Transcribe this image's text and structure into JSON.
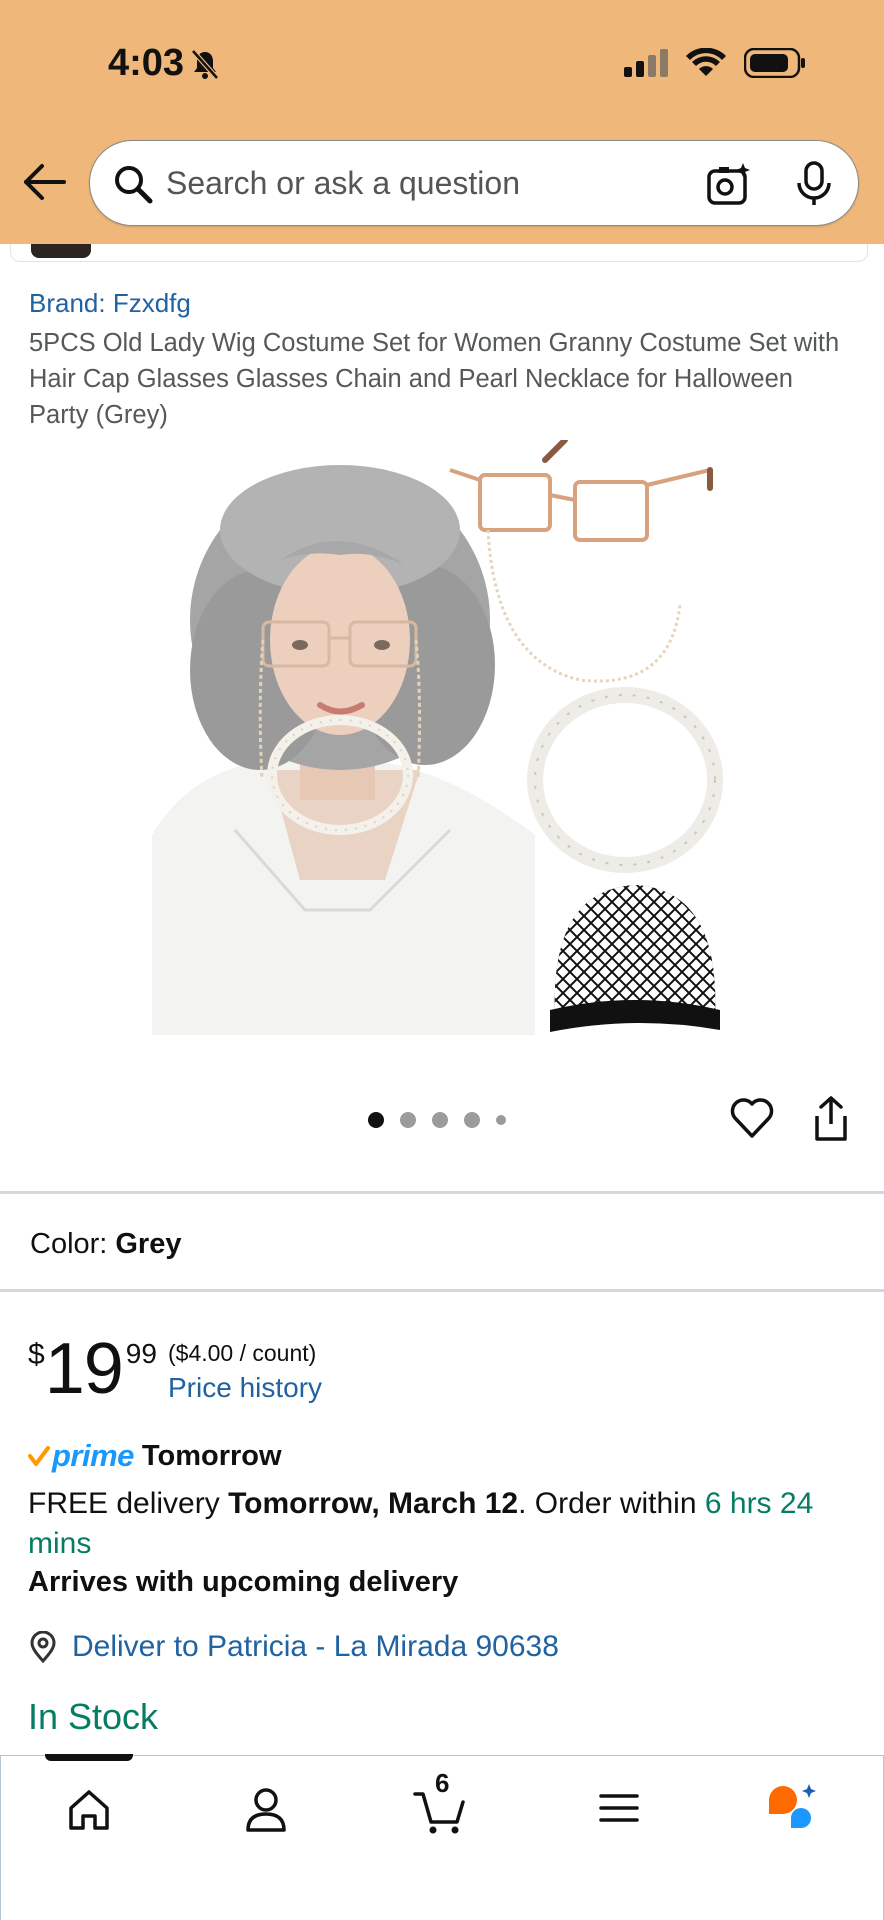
{
  "status_bar": {
    "time": "4:03"
  },
  "search": {
    "placeholder": "Search or ask a question"
  },
  "product": {
    "brand": "Brand: Fzxdfg",
    "title": "5PCS Old Lady Wig Costume Set for Women Granny Costume Set with Hair Cap Glasses Glasses Chain and Pearl Necklace for Halloween Party (Grey)",
    "image_count": 5,
    "active_image": 1
  },
  "color": {
    "label": "Color:",
    "value": "Grey"
  },
  "price": {
    "symbol": "$",
    "whole": "19",
    "fraction": "99",
    "unit_price": "($4.00 / count)",
    "history_link": "Price history"
  },
  "delivery": {
    "prime_label": "prime",
    "prime_when": "Tomorrow",
    "free_prefix": "FREE delivery ",
    "date": "Tomorrow, March 12",
    "order_within_prefix": ". Order within ",
    "countdown": "6 hrs 24 mins",
    "arrives_note": "Arrives with upcoming delivery",
    "deliver_to": "Deliver to Patricia - La Mirada 90638"
  },
  "stock": {
    "status": "In Stock"
  },
  "bottom_nav": {
    "cart_count": "6",
    "items": [
      "home",
      "account",
      "cart",
      "menu",
      "rufus"
    ]
  },
  "colors": {
    "header_bg": "#efb87a",
    "link_blue": "#2162a1",
    "stock_green": "#067d62",
    "prime_blue": "#1a98ff",
    "prime_check": "#ff9900"
  }
}
